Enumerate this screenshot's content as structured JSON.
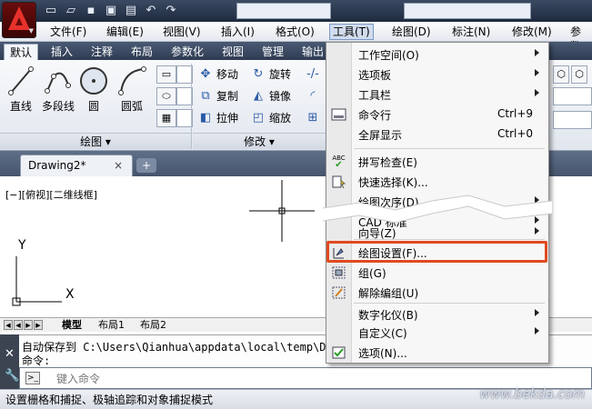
{
  "menubar": {
    "items": [
      "文件(F)",
      "编辑(E)",
      "视图(V)",
      "插入(I)",
      "格式(O)",
      "工具(T)",
      "绘图(D)",
      "标注(N)",
      "修改(M)",
      "参数"
    ],
    "active_index": 5
  },
  "ribbon": {
    "tabs": [
      "默认",
      "插入",
      "注释",
      "布局",
      "参数化",
      "视图",
      "管理",
      "输出"
    ],
    "active_tab": "默认",
    "draw_tools": [
      "直线",
      "多段线",
      "圆",
      "圆弧"
    ],
    "modify_tools": [
      "移动",
      "旋转",
      "复制",
      "镜像",
      "拉伸",
      "缩放"
    ],
    "panel_draw_label": "绘图",
    "panel_modify_label": "修改"
  },
  "file_tab": {
    "label": "Drawing2*",
    "close_glyph": "×",
    "new_glyph": "+"
  },
  "viewport_label": "[−][俯视][二维线框]",
  "axis": {
    "x": "X",
    "y": "Y"
  },
  "layout_tabs": [
    "模型",
    "布局1",
    "布局2"
  ],
  "command": {
    "history_line1": "自动保存到 C:\\Users\\Qianhua\\appdata\\local\\temp\\Du",
    "history_line2": "命令:",
    "input_placeholder": "键入命令"
  },
  "status_text": "设置栅格和捕捉、极轴追踪和对象捕捉模式",
  "tools_menu": {
    "items": [
      {
        "label": "工作空间(O)",
        "submenu": true
      },
      {
        "label": "选项板",
        "submenu": true
      },
      {
        "label": "工具栏",
        "submenu": true
      },
      {
        "label": "命令行",
        "shortcut": "Ctrl+9",
        "icon": "command-line-icon"
      },
      {
        "label": "全屏显示",
        "shortcut": "Ctrl+0"
      },
      {
        "label": "拼写检查(E)",
        "icon": "spell-check-icon",
        "icon_text": "ABC"
      },
      {
        "label": "快速选择(K)...",
        "icon": "quick-select-icon"
      },
      {
        "label": "绘图次序(D)",
        "submenu": true
      },
      {
        "label": "CAD 标准",
        "submenu": true
      },
      {
        "label": "向导(Z)",
        "submenu": true
      },
      {
        "label": "绘图设置(F)...",
        "icon": "drafting-settings-icon",
        "highlighted": true
      },
      {
        "label": "组(G)",
        "icon": "group-icon"
      },
      {
        "label": "解除编组(U)",
        "icon": "ungroup-icon"
      },
      {
        "label": "数字化仪(B)",
        "submenu": true
      },
      {
        "label": "自定义(C)",
        "submenu": true
      },
      {
        "label": "选项(N)...",
        "icon": "options-icon"
      }
    ]
  },
  "watermark": "www.bekda.com",
  "colors": {
    "highlight_border": "#e04a1f",
    "accent": "#e8322c"
  }
}
